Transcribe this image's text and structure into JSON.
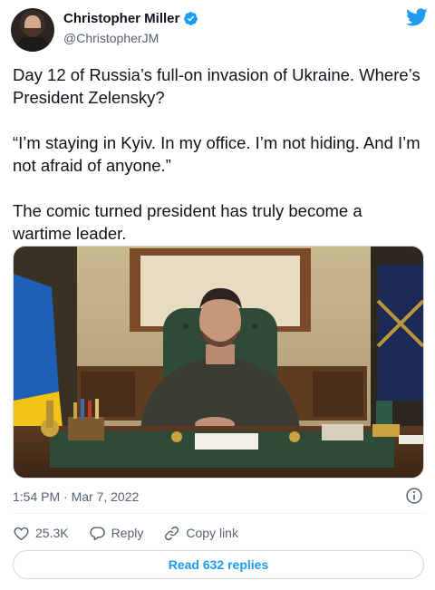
{
  "author": {
    "name": "Christopher Miller",
    "handle": "@ChristopherJM",
    "verified": true
  },
  "tweet": {
    "paragraphs": [
      "Day 12 of Russia’s full-on invasion of Ukraine. Where’s President Zelensky?",
      "“I’m staying in Kyiv. In my office. I’m not hiding. And I’m not afraid of anyone.”",
      "The comic turned president has truly become a wartime leader."
    ],
    "timestamp": "1:54 PM · Mar 7, 2022"
  },
  "actions": {
    "like_count": "25.3K",
    "reply_label": "Reply",
    "copy_link_label": "Copy link"
  },
  "read_replies_label": "Read 632 replies",
  "colors": {
    "accent": "#1d9bf0",
    "text_primary": "#0f1419",
    "text_secondary": "#536471",
    "border": "#cfd9de"
  },
  "icons": {
    "brand": "twitter-bird-icon",
    "verified": "verified-badge-icon",
    "info": "info-icon",
    "like": "heart-icon",
    "reply": "reply-bubble-icon",
    "copy_link": "link-icon"
  }
}
